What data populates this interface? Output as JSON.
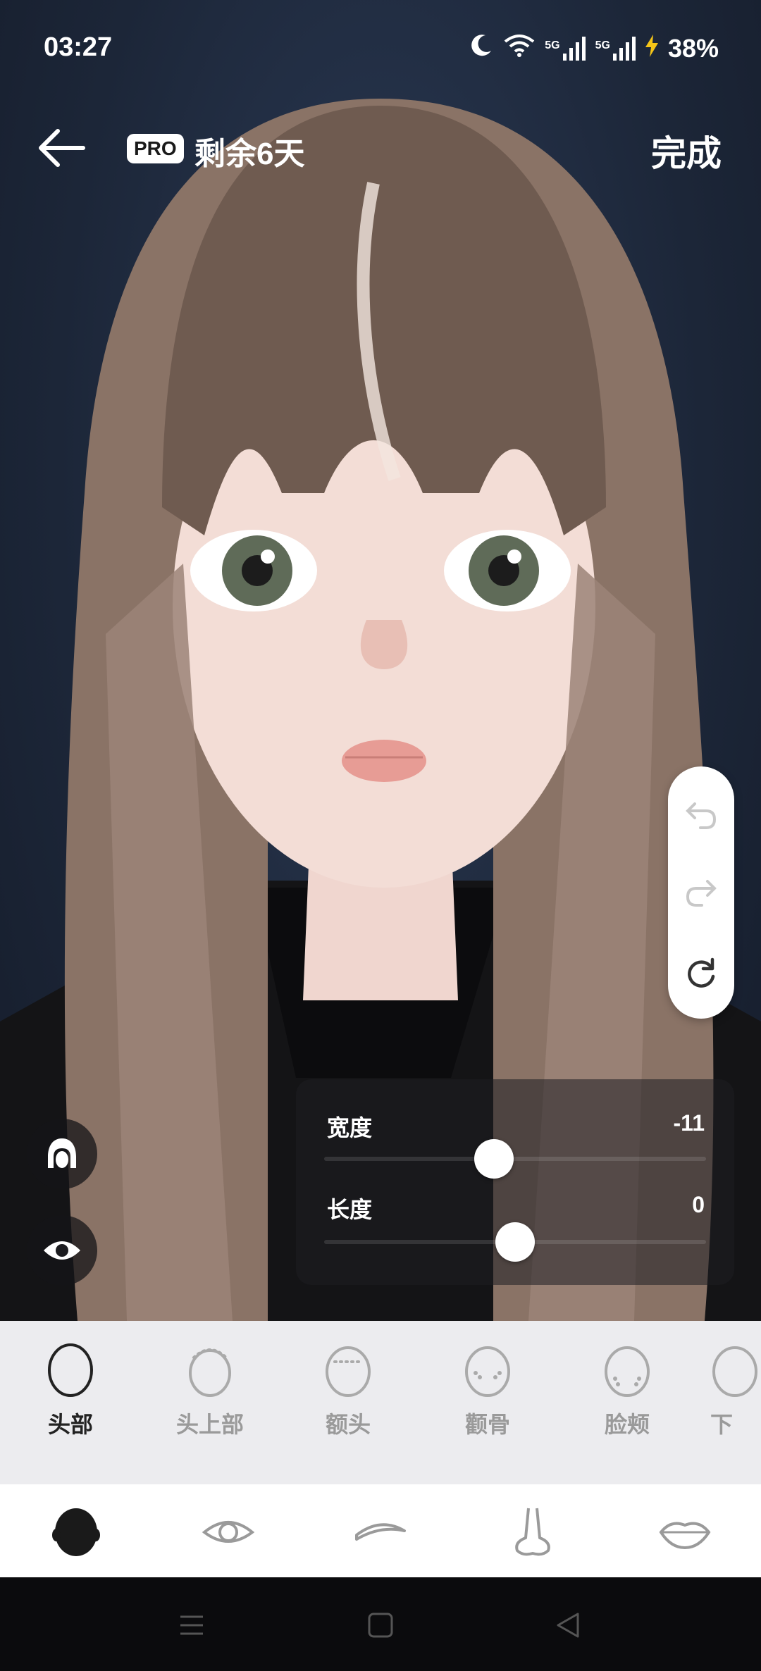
{
  "status_bar": {
    "time": "03:27",
    "network_a": "5G",
    "network_b": "5G",
    "battery": "38%"
  },
  "header": {
    "pro_badge": "PRO",
    "days_left": "剩余6天",
    "done_label": "完成"
  },
  "history_panel": {
    "icons": [
      "undo-icon",
      "redo-icon",
      "reset-icon"
    ]
  },
  "left_tools": {
    "icons": [
      "hair-toggle-icon",
      "eye-toggle-icon"
    ]
  },
  "sliders": [
    {
      "label": "宽度",
      "value": "-11",
      "level": -0.11
    },
    {
      "label": "长度",
      "value": "0",
      "level": 0
    }
  ],
  "categories": [
    {
      "label": "头部",
      "active": true
    },
    {
      "label": "头上部",
      "active": false
    },
    {
      "label": "额头",
      "active": false
    },
    {
      "label": "颧骨",
      "active": false
    },
    {
      "label": "脸颊",
      "active": false
    },
    {
      "label": "下",
      "active": false
    }
  ],
  "feature_tabs": [
    "head-icon",
    "eye-icon",
    "eyebrow-icon",
    "nose-icon",
    "lips-icon"
  ],
  "colors": {
    "accent": "#ffffff",
    "panel": "#1e1e22",
    "active_text": "#222222",
    "inactive_text": "#9a9a9a"
  }
}
